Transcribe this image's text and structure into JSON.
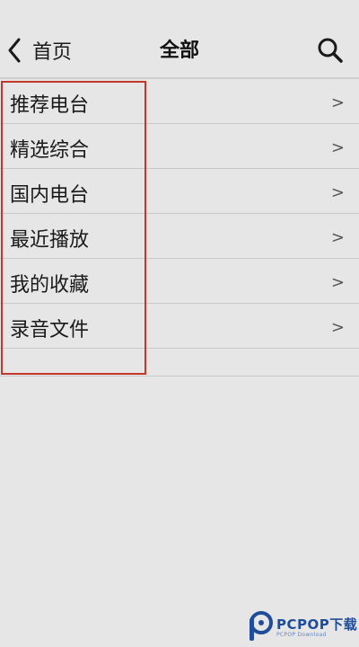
{
  "header": {
    "back_label": "首页",
    "title": "全部"
  },
  "menu": {
    "items": [
      {
        "label": "推荐电台",
        "chevron": ">"
      },
      {
        "label": "精选综合",
        "chevron": ">"
      },
      {
        "label": "国内电台",
        "chevron": ">"
      },
      {
        "label": "最近播放",
        "chevron": ">"
      },
      {
        "label": "我的收藏",
        "chevron": ">"
      },
      {
        "label": "录音文件",
        "chevron": ">"
      }
    ]
  },
  "watermark": {
    "brand": "PCPOP下载",
    "sub": "PCPOP Download"
  },
  "colors": {
    "background": "#e6e6e6",
    "highlight": "#c0392b",
    "watermark": "#1f4d99"
  }
}
